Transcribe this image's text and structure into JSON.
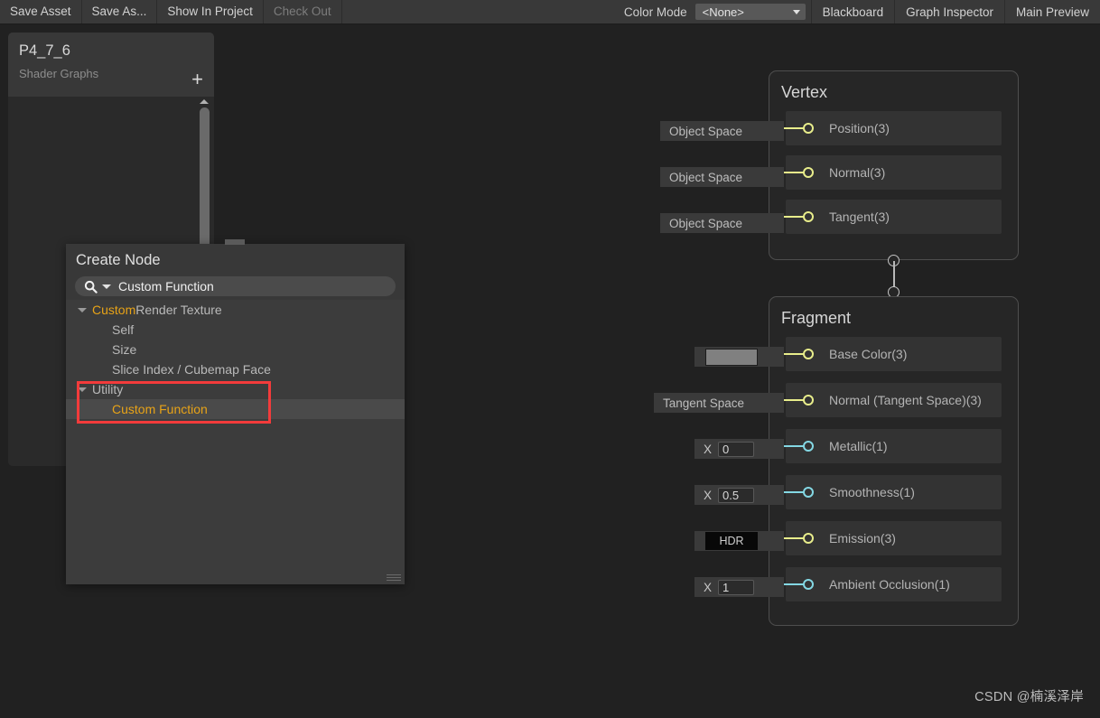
{
  "toolbar": {
    "buttons": [
      {
        "label": "Save Asset",
        "disabled": false
      },
      {
        "label": "Save As...",
        "disabled": false
      },
      {
        "label": "Show In Project",
        "disabled": false
      },
      {
        "label": "Check Out",
        "disabled": true
      }
    ],
    "color_mode_label": "Color Mode",
    "color_mode_value": "<None>",
    "toggles": [
      {
        "label": "Blackboard"
      },
      {
        "label": "Graph Inspector"
      },
      {
        "label": "Main Preview"
      }
    ]
  },
  "blackboard": {
    "title": "P4_7_6",
    "subtitle": "Shader Graphs",
    "add_label": "+"
  },
  "searcher": {
    "title": "Create Node",
    "search_value": "Custom Function",
    "search_placeholder": "Search",
    "results": [
      {
        "kind": "group",
        "prefix": "Custom",
        "rest": " Render Texture",
        "highlight": true,
        "selected": false
      },
      {
        "kind": "item",
        "label": "Self",
        "amber": false,
        "selected": false
      },
      {
        "kind": "item",
        "label": "Size",
        "amber": false,
        "selected": false
      },
      {
        "kind": "item",
        "label": "Slice Index / Cubemap Face",
        "amber": false,
        "selected": false
      },
      {
        "kind": "group",
        "prefix": "Utility",
        "rest": "",
        "highlight": false,
        "selected": false
      },
      {
        "kind": "item",
        "label": "Custom Function",
        "amber": true,
        "selected": true
      }
    ]
  },
  "graph": {
    "vertex": {
      "title": "Vertex",
      "ports": [
        {
          "label": "Position(3)",
          "control": "Object Space",
          "type": "vector"
        },
        {
          "label": "Normal(3)",
          "control": "Object Space",
          "type": "vector"
        },
        {
          "label": "Tangent(3)",
          "control": "Object Space",
          "type": "vector"
        }
      ]
    },
    "fragment": {
      "title": "Fragment",
      "ports": [
        {
          "label": "Base Color(3)",
          "control": "swatch",
          "value": "",
          "type": "vector"
        },
        {
          "label": "Normal (Tangent Space)(3)",
          "control": "Tangent Space",
          "type": "vector"
        },
        {
          "label": "Metallic(1)",
          "control": "X",
          "value": "0",
          "type": "float"
        },
        {
          "label": "Smoothness(1)",
          "control": "X",
          "value": "0.5",
          "type": "float"
        },
        {
          "label": "Emission(3)",
          "control": "hdr",
          "value": "HDR",
          "type": "vector"
        },
        {
          "label": "Ambient Occlusion(1)",
          "control": "X",
          "value": "1",
          "type": "float"
        }
      ]
    }
  },
  "watermark": "CSDN @楠溪泽岸",
  "colors": {
    "accent_amber": "#e8a317",
    "wire_vector": "#e8ed8b",
    "wire_float": "#84d8e4",
    "highlight_box": "#f33b3b",
    "swatch": "#808080"
  }
}
